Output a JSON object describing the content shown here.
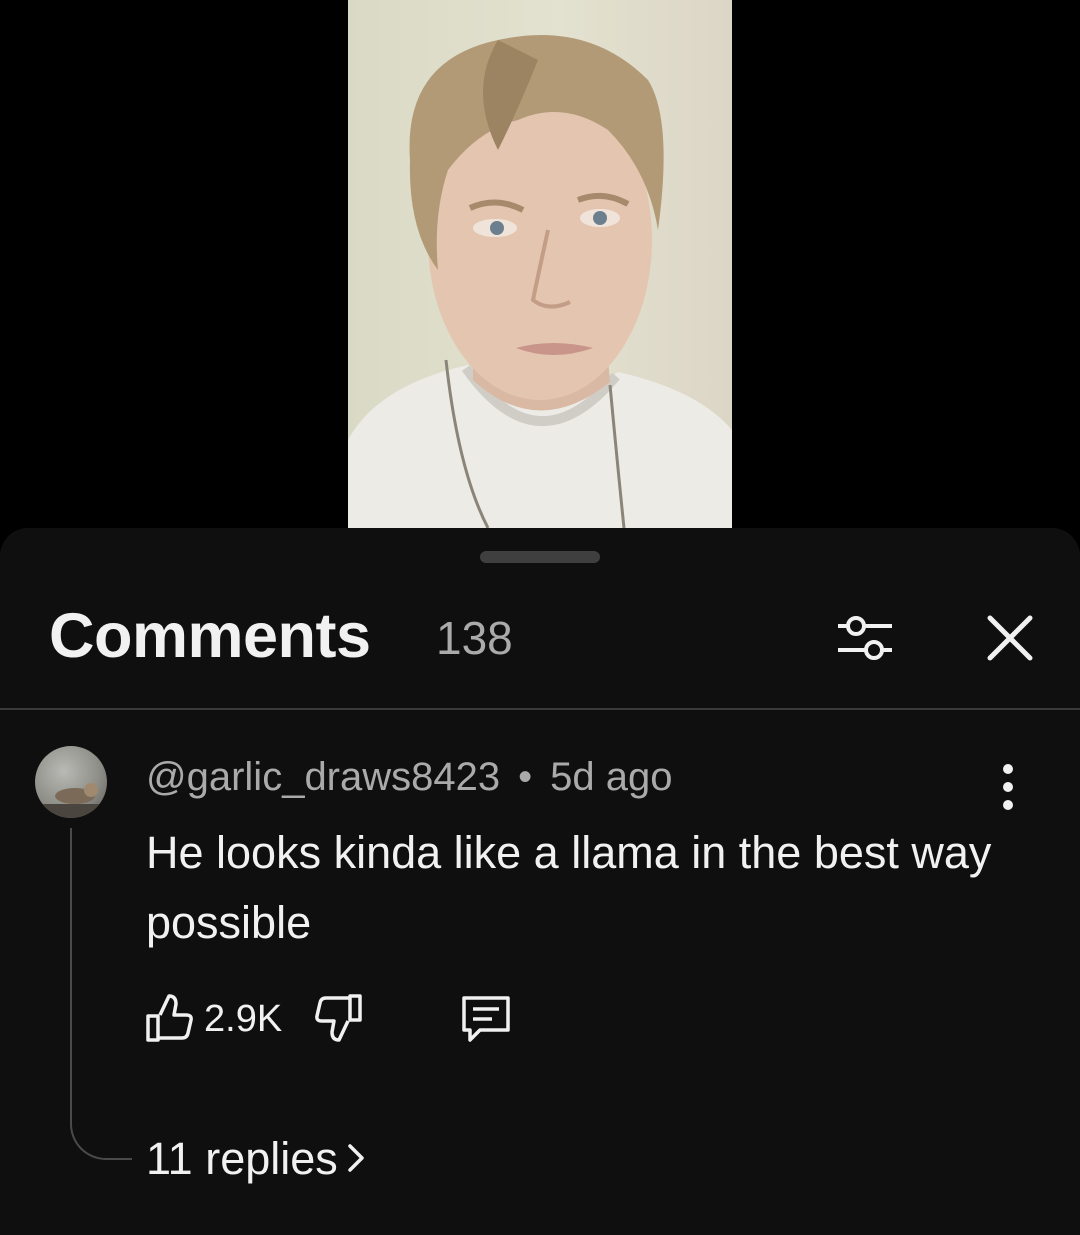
{
  "video": {
    "thumbnail_icon": "person-portrait-icon"
  },
  "comments_panel": {
    "title": "Comments",
    "count": "138",
    "filter_icon": "sliders-icon",
    "close_icon": "close-icon"
  },
  "comment": {
    "author": "@garlic_draws8423",
    "separator": "•",
    "time": "5d ago",
    "text": "He looks kinda like a llama in the best way possible",
    "like_count": "2.9K",
    "like_icon": "thumbs-up-icon",
    "dislike_icon": "thumbs-down-icon",
    "reply_icon": "reply-comment-icon",
    "more_icon": "more-vertical-icon",
    "replies_label": "11 replies"
  },
  "colors": {
    "sheet_background": "#0f0f0f",
    "primary_text": "#f1f1f1",
    "secondary_text": "#aaaaaa"
  }
}
